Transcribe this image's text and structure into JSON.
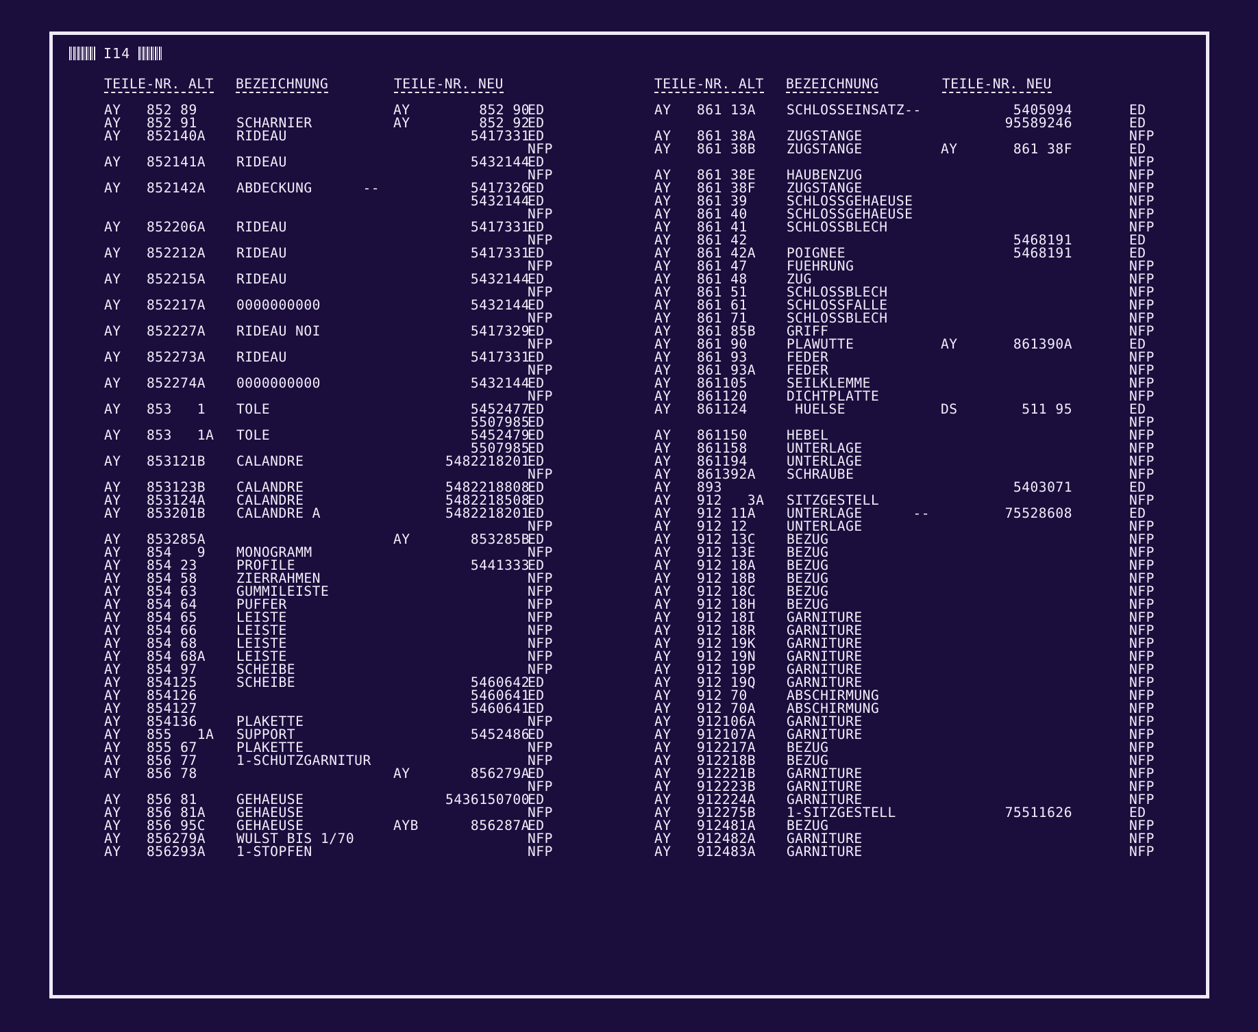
{
  "header": {
    "page_code": "I14"
  },
  "columns": {
    "old_part_no": "TEILE-NR. ALT",
    "description": "BEZEICHNUNG",
    "new_part_no": "TEILE-NR. NEU"
  },
  "left_rows": [
    {
      "pre": "AY",
      "num": "852 89",
      "desc": "",
      "npre": "AY",
      "new": "852 90",
      "flag": "ED"
    },
    {
      "pre": "AY",
      "num": "852 91",
      "desc": "SCHARNIER",
      "npre": "AY",
      "new": "852 92",
      "flag": "ED"
    },
    {
      "pre": "AY",
      "num": "852140A",
      "desc": "RIDEAU",
      "npre": "",
      "new": "5417331",
      "flag": "ED"
    },
    {
      "pre": "",
      "num": "",
      "desc": "",
      "npre": "",
      "new": "",
      "flag": "NFP"
    },
    {
      "pre": "AY",
      "num": "852141A",
      "desc": "RIDEAU",
      "npre": "",
      "new": "5432144",
      "flag": "ED"
    },
    {
      "pre": "",
      "num": "",
      "desc": "",
      "npre": "",
      "new": "",
      "flag": "NFP"
    },
    {
      "pre": "AY",
      "num": "852142A",
      "desc": "ABDECKUNG      --",
      "npre": "",
      "new": "5417326",
      "flag": "ED"
    },
    {
      "pre": "",
      "num": "",
      "desc": "",
      "npre": "",
      "new": "5432144",
      "flag": "ED"
    },
    {
      "pre": "",
      "num": "",
      "desc": "",
      "npre": "",
      "new": "",
      "flag": "NFP"
    },
    {
      "pre": "AY",
      "num": "852206A",
      "desc": "RIDEAU",
      "npre": "",
      "new": "5417331",
      "flag": "ED"
    },
    {
      "pre": "",
      "num": "",
      "desc": "",
      "npre": "",
      "new": "",
      "flag": "NFP"
    },
    {
      "pre": "AY",
      "num": "852212A",
      "desc": "RIDEAU",
      "npre": "",
      "new": "5417331",
      "flag": "ED"
    },
    {
      "pre": "",
      "num": "",
      "desc": "",
      "npre": "",
      "new": "",
      "flag": "NFP"
    },
    {
      "pre": "AY",
      "num": "852215A",
      "desc": "RIDEAU",
      "npre": "",
      "new": "5432144",
      "flag": "ED"
    },
    {
      "pre": "",
      "num": "",
      "desc": "",
      "npre": "",
      "new": "",
      "flag": "NFP"
    },
    {
      "pre": "AY",
      "num": "852217A",
      "desc": "0000000000",
      "npre": "",
      "new": "5432144",
      "flag": "ED"
    },
    {
      "pre": "",
      "num": "",
      "desc": "",
      "npre": "",
      "new": "",
      "flag": "NFP"
    },
    {
      "pre": "AY",
      "num": "852227A",
      "desc": "RIDEAU NOI",
      "npre": "",
      "new": "5417329",
      "flag": "ED"
    },
    {
      "pre": "",
      "num": "",
      "desc": "",
      "npre": "",
      "new": "",
      "flag": "NFP"
    },
    {
      "pre": "AY",
      "num": "852273A",
      "desc": "RIDEAU",
      "npre": "",
      "new": "5417331",
      "flag": "ED"
    },
    {
      "pre": "",
      "num": "",
      "desc": "",
      "npre": "",
      "new": "",
      "flag": "NFP"
    },
    {
      "pre": "AY",
      "num": "852274A",
      "desc": "0000000000",
      "npre": "",
      "new": "5432144",
      "flag": "ED"
    },
    {
      "pre": "",
      "num": "",
      "desc": "",
      "npre": "",
      "new": "",
      "flag": "NFP"
    },
    {
      "pre": "AY",
      "num": "853   1",
      "desc": "TOLE",
      "npre": "",
      "new": "5452477",
      "flag": "ED"
    },
    {
      "pre": "",
      "num": "",
      "desc": "",
      "npre": "",
      "new": "5507985",
      "flag": "ED"
    },
    {
      "pre": "AY",
      "num": "853   1A",
      "desc": "TOLE",
      "npre": "",
      "new": "5452479",
      "flag": "ED"
    },
    {
      "pre": "",
      "num": "",
      "desc": "",
      "npre": "",
      "new": "5507985",
      "flag": "ED"
    },
    {
      "pre": "AY",
      "num": "853121B",
      "desc": "CALANDRE",
      "npre": "",
      "new": "5482218201",
      "flag": "ED"
    },
    {
      "pre": "",
      "num": "",
      "desc": "",
      "npre": "",
      "new": "",
      "flag": "NFP"
    },
    {
      "pre": "AY",
      "num": "853123B",
      "desc": "CALANDRE",
      "npre": "",
      "new": "5482218808",
      "flag": "ED"
    },
    {
      "pre": "AY",
      "num": "853124A",
      "desc": "CALANDRE",
      "npre": "",
      "new": "5482218508",
      "flag": "ED"
    },
    {
      "pre": "AY",
      "num": "853201B",
      "desc": "CALANDRE A",
      "npre": "",
      "new": "5482218201",
      "flag": "ED"
    },
    {
      "pre": "",
      "num": "",
      "desc": "",
      "npre": "",
      "new": "",
      "flag": "NFP"
    },
    {
      "pre": "AY",
      "num": "853285A",
      "desc": "",
      "npre": "AY",
      "new": "853285B",
      "flag": "ED"
    },
    {
      "pre": "AY",
      "num": "854   9",
      "desc": "MONOGRAMM",
      "npre": "",
      "new": "",
      "flag": "NFP"
    },
    {
      "pre": "AY",
      "num": "854 23",
      "desc": "PROFILE",
      "npre": "",
      "new": "5441333",
      "flag": "ED"
    },
    {
      "pre": "AY",
      "num": "854 58",
      "desc": "ZIERRAHMEN",
      "npre": "",
      "new": "",
      "flag": "NFP"
    },
    {
      "pre": "AY",
      "num": "854 63",
      "desc": "GUMMILEISTE",
      "npre": "",
      "new": "",
      "flag": "NFP"
    },
    {
      "pre": "AY",
      "num": "854 64",
      "desc": "PUFFER",
      "npre": "",
      "new": "",
      "flag": "NFP"
    },
    {
      "pre": "AY",
      "num": "854 65",
      "desc": "LEISTE",
      "npre": "",
      "new": "",
      "flag": "NFP"
    },
    {
      "pre": "AY",
      "num": "854 66",
      "desc": "LEISTE",
      "npre": "",
      "new": "",
      "flag": "NFP"
    },
    {
      "pre": "AY",
      "num": "854 68",
      "desc": "LEISTE",
      "npre": "",
      "new": "",
      "flag": "NFP"
    },
    {
      "pre": "AY",
      "num": "854 68A",
      "desc": "LEISTE",
      "npre": "",
      "new": "",
      "flag": "NFP"
    },
    {
      "pre": "AY",
      "num": "854 97",
      "desc": "SCHEIBE",
      "npre": "",
      "new": "",
      "flag": "NFP"
    },
    {
      "pre": "AY",
      "num": "854125",
      "desc": "SCHEIBE",
      "npre": "",
      "new": "5460642",
      "flag": "ED"
    },
    {
      "pre": "AY",
      "num": "854126",
      "desc": "",
      "npre": "",
      "new": "5460641",
      "flag": "ED"
    },
    {
      "pre": "AY",
      "num": "854127",
      "desc": "",
      "npre": "",
      "new": "5460641",
      "flag": "ED"
    },
    {
      "pre": "AY",
      "num": "854136",
      "desc": "PLAKETTE",
      "npre": "",
      "new": "",
      "flag": "NFP"
    },
    {
      "pre": "AY",
      "num": "855   1A",
      "desc": "SUPPORT",
      "npre": "",
      "new": "5452486",
      "flag": "ED"
    },
    {
      "pre": "AY",
      "num": "855 67",
      "desc": "PLAKETTE",
      "npre": "",
      "new": "",
      "flag": "NFP"
    },
    {
      "pre": "AY",
      "num": "856 77",
      "desc": "1-SCHUTZGARNITUR",
      "npre": "",
      "new": "",
      "flag": "NFP"
    },
    {
      "pre": "AY",
      "num": "856 78",
      "desc": "",
      "npre": "AY",
      "new": "856279A",
      "flag": "ED"
    },
    {
      "pre": "",
      "num": "",
      "desc": "",
      "npre": "",
      "new": "",
      "flag": "NFP"
    },
    {
      "pre": "AY",
      "num": "856 81",
      "desc": "GEHAEUSE",
      "npre": "",
      "new": "5436150700",
      "flag": "ED"
    },
    {
      "pre": "AY",
      "num": "856 81A",
      "desc": "GEHAEUSE",
      "npre": "",
      "new": "",
      "flag": "NFP"
    },
    {
      "pre": "AY",
      "num": "856 95C",
      "desc": "GEHAEUSE",
      "npre": "AYB",
      "new": "856287A",
      "flag": "ED"
    },
    {
      "pre": "AY",
      "num": "856279A",
      "desc": "WULST BIS 1/70",
      "npre": "",
      "new": "",
      "flag": "NFP"
    },
    {
      "pre": "AY",
      "num": "856293A",
      "desc": "1-STOPFEN",
      "npre": "",
      "new": "",
      "flag": "NFP"
    }
  ],
  "right_rows": [
    {
      "pre": "AY",
      "num": "861 13A",
      "desc": "SCHLOSSEINSATZ--",
      "npre": "",
      "new": "5405094",
      "flag": "ED"
    },
    {
      "pre": "",
      "num": "",
      "desc": "",
      "npre": "",
      "new": "95589246",
      "flag": "ED"
    },
    {
      "pre": "AY",
      "num": "861 38A",
      "desc": "ZUGSTANGE",
      "npre": "",
      "new": "",
      "flag": "NFP"
    },
    {
      "pre": "AY",
      "num": "861 38B",
      "desc": "ZUGSTANGE",
      "npre": "AY",
      "new": "861 38F",
      "flag": "ED"
    },
    {
      "pre": "",
      "num": "",
      "desc": "",
      "npre": "",
      "new": "",
      "flag": "NFP"
    },
    {
      "pre": "AY",
      "num": "861 38E",
      "desc": "HAUBENZUG",
      "npre": "",
      "new": "",
      "flag": "NFP"
    },
    {
      "pre": "AY",
      "num": "861 38F",
      "desc": "ZUGSTANGE",
      "npre": "",
      "new": "",
      "flag": "NFP"
    },
    {
      "pre": "AY",
      "num": "861 39",
      "desc": "SCHLOSSGEHAEUSE",
      "npre": "",
      "new": "",
      "flag": "NFP"
    },
    {
      "pre": "AY",
      "num": "861 40",
      "desc": "SCHLOSSGEHAEUSE",
      "npre": "",
      "new": "",
      "flag": "NFP"
    },
    {
      "pre": "AY",
      "num": "861 41",
      "desc": "SCHLOSSBLECH",
      "npre": "",
      "new": "",
      "flag": "NFP"
    },
    {
      "pre": "AY",
      "num": "861 42",
      "desc": "",
      "npre": "",
      "new": "5468191",
      "flag": "ED"
    },
    {
      "pre": "AY",
      "num": "861 42A",
      "desc": "POIGNEE",
      "npre": "",
      "new": "5468191",
      "flag": "ED"
    },
    {
      "pre": "AY",
      "num": "861 47",
      "desc": "FUEHRUNG",
      "npre": "",
      "new": "",
      "flag": "NFP"
    },
    {
      "pre": "AY",
      "num": "861 48",
      "desc": "ZUG",
      "npre": "",
      "new": "",
      "flag": "NFP"
    },
    {
      "pre": "AY",
      "num": "861 51",
      "desc": "SCHLOSSBLECH",
      "npre": "",
      "new": "",
      "flag": "NFP"
    },
    {
      "pre": "AY",
      "num": "861 61",
      "desc": "SCHLOSSFALLE",
      "npre": "",
      "new": "",
      "flag": "NFP"
    },
    {
      "pre": "AY",
      "num": "861 71",
      "desc": "SCHLOSSBLECH",
      "npre": "",
      "new": "",
      "flag": "NFP"
    },
    {
      "pre": "AY",
      "num": "861 85B",
      "desc": "GRIFF",
      "npre": "",
      "new": "",
      "flag": "NFP"
    },
    {
      "pre": "AY",
      "num": "861 90",
      "desc": "PLAWUTTE",
      "npre": "AY",
      "new": "861390A",
      "flag": "ED"
    },
    {
      "pre": "AY",
      "num": "861 93",
      "desc": "FEDER",
      "npre": "",
      "new": "",
      "flag": "NFP"
    },
    {
      "pre": "AY",
      "num": "861 93A",
      "desc": "FEDER",
      "npre": "",
      "new": "",
      "flag": "NFP"
    },
    {
      "pre": "AY",
      "num": "861105",
      "desc": "SEILKLEMME",
      "npre": "",
      "new": "",
      "flag": "NFP"
    },
    {
      "pre": "AY",
      "num": "861120",
      "desc": "DICHTPLATTE",
      "npre": "",
      "new": "",
      "flag": "NFP"
    },
    {
      "pre": "AY",
      "num": "861124",
      "desc": " HUELSE",
      "npre": "DS",
      "new": "511 95",
      "flag": "ED"
    },
    {
      "pre": "",
      "num": "",
      "desc": "",
      "npre": "",
      "new": "",
      "flag": "NFP"
    },
    {
      "pre": "AY",
      "num": "861150",
      "desc": "HEBEL",
      "npre": "",
      "new": "",
      "flag": "NFP"
    },
    {
      "pre": "AY",
      "num": "861158",
      "desc": "UNTERLAGE",
      "npre": "",
      "new": "",
      "flag": "NFP"
    },
    {
      "pre": "AY",
      "num": "861194",
      "desc": "UNTERLAGE",
      "npre": "",
      "new": "",
      "flag": "NFP"
    },
    {
      "pre": "AY",
      "num": "861392A",
      "desc": "SCHRAUBE",
      "npre": "",
      "new": "",
      "flag": "NFP"
    },
    {
      "pre": "AY",
      "num": "893",
      "desc": "",
      "npre": "",
      "new": "5403071",
      "flag": "ED"
    },
    {
      "pre": "AY",
      "num": "912   3A",
      "desc": "SITZGESTELL",
      "npre": "",
      "new": "",
      "flag": "NFP"
    },
    {
      "pre": "AY",
      "num": "912 11A",
      "desc": "UNTERLAGE      --",
      "npre": "",
      "new": "75528608",
      "flag": "ED"
    },
    {
      "pre": "AY",
      "num": "912 12",
      "desc": "UNTERLAGE",
      "npre": "",
      "new": "",
      "flag": "NFP"
    },
    {
      "pre": "AY",
      "num": "912 13C",
      "desc": "BEZUG",
      "npre": "",
      "new": "",
      "flag": "NFP"
    },
    {
      "pre": "AY",
      "num": "912 13E",
      "desc": "BEZUG",
      "npre": "",
      "new": "",
      "flag": "NFP"
    },
    {
      "pre": "AY",
      "num": "912 18A",
      "desc": "BEZUG",
      "npre": "",
      "new": "",
      "flag": "NFP"
    },
    {
      "pre": "AY",
      "num": "912 18B",
      "desc": "BEZUG",
      "npre": "",
      "new": "",
      "flag": "NFP"
    },
    {
      "pre": "AY",
      "num": "912 18C",
      "desc": "BEZUG",
      "npre": "",
      "new": "",
      "flag": "NFP"
    },
    {
      "pre": "AY",
      "num": "912 18H",
      "desc": "BEZUG",
      "npre": "",
      "new": "",
      "flag": "NFP"
    },
    {
      "pre": "AY",
      "num": "912 18I",
      "desc": "GARNITURE",
      "npre": "",
      "new": "",
      "flag": "NFP"
    },
    {
      "pre": "AY",
      "num": "912 18R",
      "desc": "GARNITURE",
      "npre": "",
      "new": "",
      "flag": "NFP"
    },
    {
      "pre": "AY",
      "num": "912 19K",
      "desc": "GARNITURE",
      "npre": "",
      "new": "",
      "flag": "NFP"
    },
    {
      "pre": "AY",
      "num": "912 19N",
      "desc": "GARNITURE",
      "npre": "",
      "new": "",
      "flag": "NFP"
    },
    {
      "pre": "AY",
      "num": "912 19P",
      "desc": "GARNITURE",
      "npre": "",
      "new": "",
      "flag": "NFP"
    },
    {
      "pre": "AY",
      "num": "912 19Q",
      "desc": "GARNITURE",
      "npre": "",
      "new": "",
      "flag": "NFP"
    },
    {
      "pre": "AY",
      "num": "912 70",
      "desc": "ABSCHIRMUNG",
      "npre": "",
      "new": "",
      "flag": "NFP"
    },
    {
      "pre": "AY",
      "num": "912 70A",
      "desc": "ABSCHIRMUNG",
      "npre": "",
      "new": "",
      "flag": "NFP"
    },
    {
      "pre": "AY",
      "num": "912106A",
      "desc": "GARNITURE",
      "npre": "",
      "new": "",
      "flag": "NFP"
    },
    {
      "pre": "AY",
      "num": "912107A",
      "desc": "GARNITURE",
      "npre": "",
      "new": "",
      "flag": "NFP"
    },
    {
      "pre": "AY",
      "num": "912217A",
      "desc": "BEZUG",
      "npre": "",
      "new": "",
      "flag": "NFP"
    },
    {
      "pre": "AY",
      "num": "912218B",
      "desc": "BEZUG",
      "npre": "",
      "new": "",
      "flag": "NFP"
    },
    {
      "pre": "AY",
      "num": "912221B",
      "desc": "GARNITURE",
      "npre": "",
      "new": "",
      "flag": "NFP"
    },
    {
      "pre": "AY",
      "num": "912223B",
      "desc": "GARNITURE",
      "npre": "",
      "new": "",
      "flag": "NFP"
    },
    {
      "pre": "AY",
      "num": "912224A",
      "desc": "GARNITURE",
      "npre": "",
      "new": "",
      "flag": "NFP"
    },
    {
      "pre": "AY",
      "num": "912275B",
      "desc": "1-SITZGESTELL",
      "npre": "",
      "new": "75511626",
      "flag": "ED"
    },
    {
      "pre": "AY",
      "num": "912481A",
      "desc": "BEZUG",
      "npre": "",
      "new": "",
      "flag": "NFP"
    },
    {
      "pre": "AY",
      "num": "912482A",
      "desc": "GARNITURE",
      "npre": "",
      "new": "",
      "flag": "NFP"
    },
    {
      "pre": "AY",
      "num": "912483A",
      "desc": "GARNITURE",
      "npre": "",
      "new": "",
      "flag": "NFP"
    }
  ]
}
